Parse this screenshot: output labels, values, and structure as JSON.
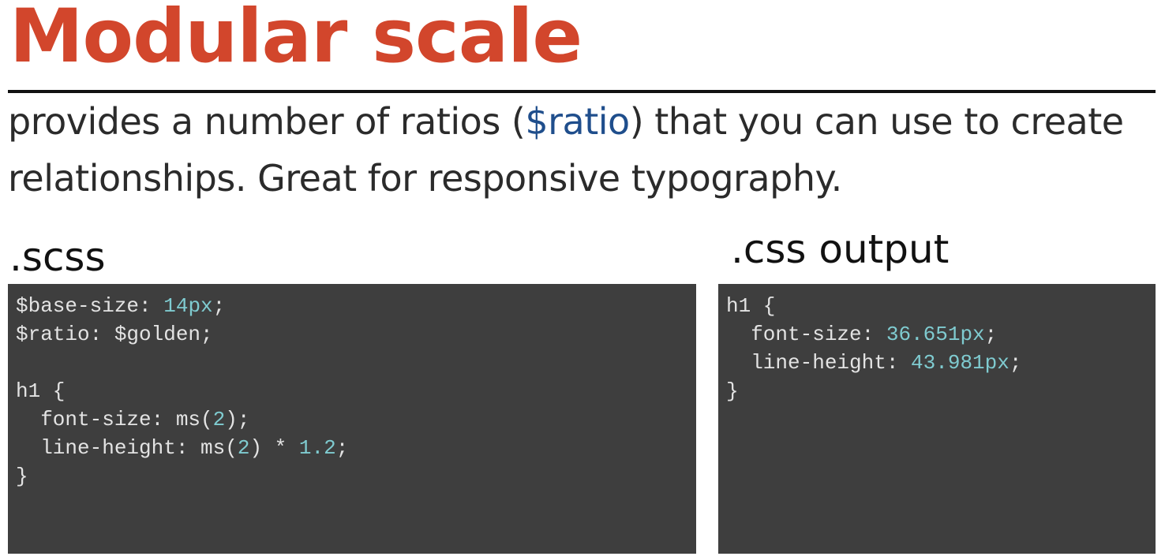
{
  "title": "Modular scale",
  "lead": {
    "before": "provides a number of ratios (",
    "var": "$ratio",
    "after": ") that you can use to create relationships. Great for responsive typography."
  },
  "colors": {
    "title": "#d2462c",
    "variable": "#1f4e8c",
    "code_background": "#3e3e3e",
    "code_text": "#e3e3e3",
    "code_number": "#7fcbd0"
  },
  "scss_panel": {
    "label": ".scss",
    "lines": [
      [
        {
          "t": "$base-size: ",
          "c": "txt"
        },
        {
          "t": "14px",
          "c": "num"
        },
        {
          "t": ";",
          "c": "txt"
        }
      ],
      [
        {
          "t": "$ratio: $golden;",
          "c": "txt"
        }
      ],
      [],
      [
        {
          "t": "h1 {",
          "c": "txt"
        }
      ],
      [
        {
          "t": "  font-size: ms(",
          "c": "txt"
        },
        {
          "t": "2",
          "c": "num"
        },
        {
          "t": ");",
          "c": "txt"
        }
      ],
      [
        {
          "t": "  line-height: ms(",
          "c": "txt"
        },
        {
          "t": "2",
          "c": "num"
        },
        {
          "t": ") * ",
          "c": "txt"
        },
        {
          "t": "1.2",
          "c": "num"
        },
        {
          "t": ";",
          "c": "txt"
        }
      ],
      [
        {
          "t": "}",
          "c": "txt"
        }
      ]
    ]
  },
  "css_panel": {
    "label": ".css output",
    "lines": [
      [
        {
          "t": "h1 {",
          "c": "txt"
        }
      ],
      [
        {
          "t": "  font-size: ",
          "c": "txt"
        },
        {
          "t": "36.651px",
          "c": "num"
        },
        {
          "t": ";",
          "c": "txt"
        }
      ],
      [
        {
          "t": "  line-height: ",
          "c": "txt"
        },
        {
          "t": "43.981px",
          "c": "num"
        },
        {
          "t": ";",
          "c": "txt"
        }
      ],
      [
        {
          "t": "}",
          "c": "txt"
        }
      ]
    ]
  }
}
